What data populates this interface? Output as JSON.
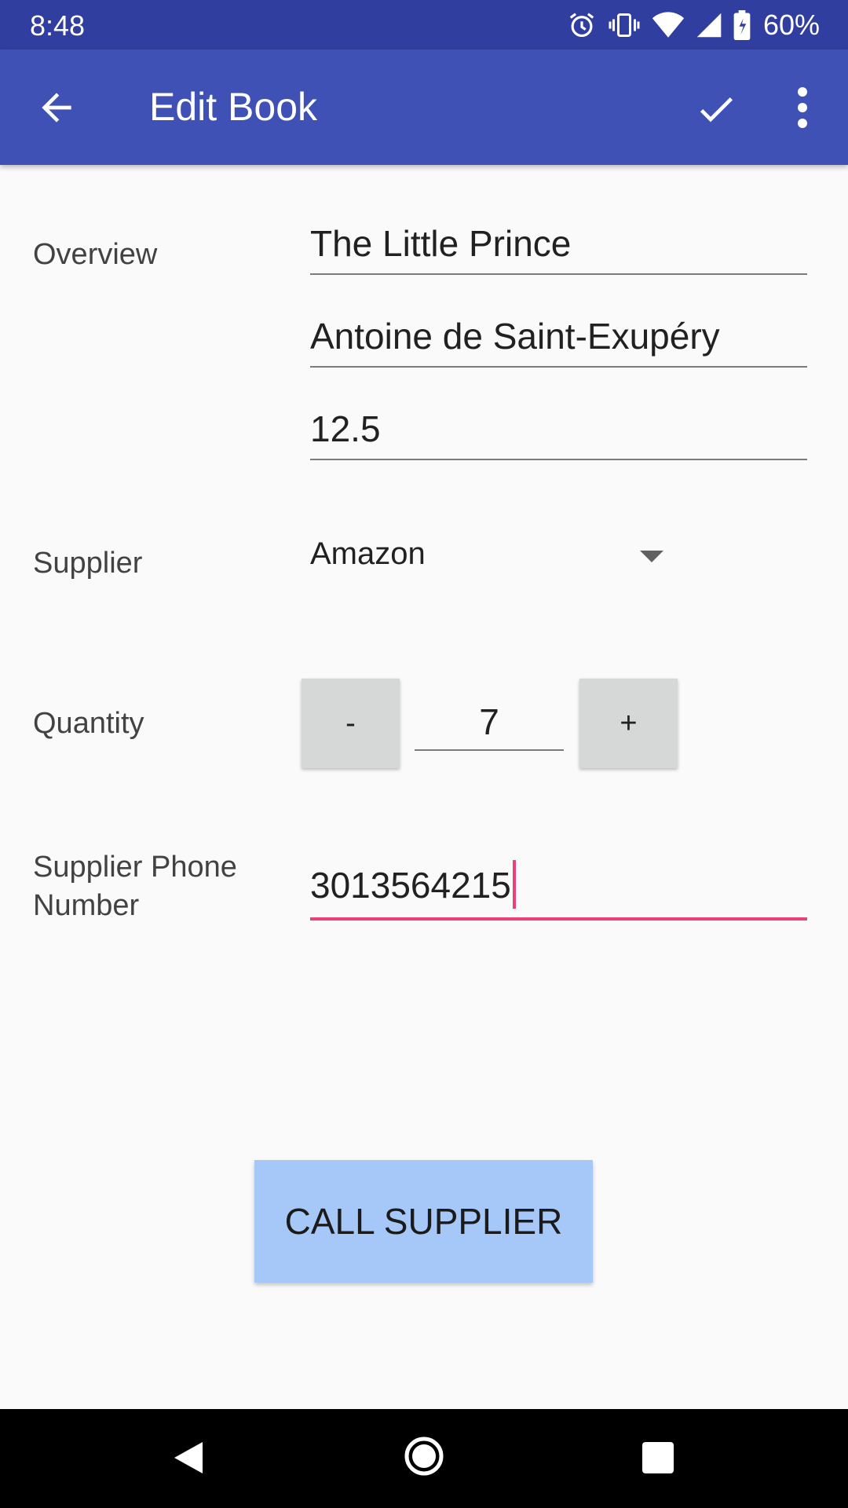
{
  "status_bar": {
    "time": "8:48",
    "battery": "60%",
    "icons": [
      "alarm-icon",
      "vibrate-icon",
      "wifi-icon",
      "signal-icon",
      "battery-icon"
    ]
  },
  "app_bar": {
    "title": "Edit Book",
    "icons": [
      "back-arrow-icon",
      "check-icon",
      "more-vert-icon"
    ]
  },
  "form": {
    "overview_label": "Overview",
    "book_name": "The Little Prince",
    "author": "Antoine de Saint-Exupéry",
    "price": "12.5",
    "supplier_label": "Supplier",
    "supplier_value": "Amazon",
    "quantity_label": "Quantity",
    "decrement_label": "-",
    "quantity_value": "7",
    "increment_label": "+",
    "phone_label_line1": "Supplier Phone",
    "phone_label_line2": "Number",
    "phone_value": "3013564215"
  },
  "call_button_label": "CALL SUPPLIER",
  "nav_bar": {
    "icons": [
      "nav-back-icon",
      "nav-home-icon",
      "nav-recents-icon"
    ]
  },
  "colors": {
    "status_bar": "#303f9f",
    "app_bar": "#3f51b5",
    "accent": "#ec407a",
    "call_button": "#a6c8f8"
  }
}
